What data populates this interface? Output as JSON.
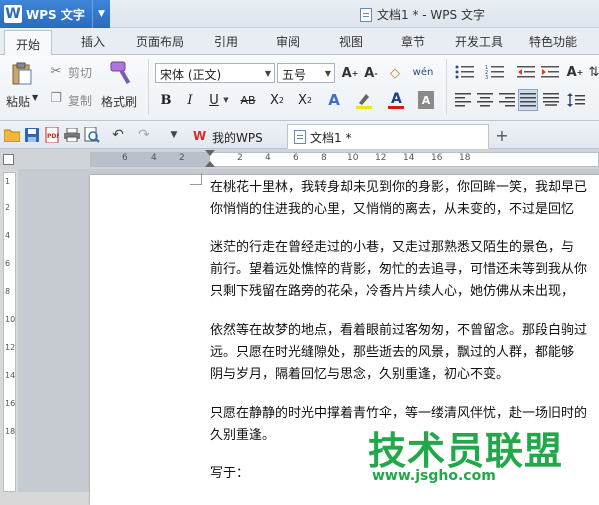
{
  "app": {
    "name": "WPS 文字",
    "window_title": "文档1 * - WPS 文字"
  },
  "ribbon_tabs": [
    "开始",
    "插入",
    "页面布局",
    "引用",
    "审阅",
    "视图",
    "章节",
    "开发工具",
    "特色功能"
  ],
  "clipboard": {
    "paste": "粘贴",
    "cut": "剪切",
    "copy": "复制",
    "format_painter": "格式刷"
  },
  "font": {
    "family": "宋体 (正文)",
    "size": "五号",
    "font_color": "#d21c1c",
    "highlight_color": "#f2e21b"
  },
  "document_tabs": [
    {
      "label": "我的WPS"
    },
    {
      "label": "文档1 *"
    }
  ],
  "ruler": {
    "h_numbers": [
      "6",
      "4",
      "2",
      "2",
      "4",
      "6",
      "8",
      "10",
      "12",
      "14",
      "16",
      "18"
    ],
    "v_numbers": [
      "1",
      "2",
      "4",
      "6",
      "8",
      "10",
      "12",
      "14",
      "16",
      "18"
    ]
  },
  "document": {
    "paragraphs": [
      {
        "lines": [
          "在桃花十里林，我转身却未见到你的身影，你回眸一笑，我却早已",
          "你悄悄的住进我的心里，又悄悄的离去，从未变的，不过是回忆"
        ]
      },
      {
        "lines": [
          "迷茫的行走在曾经走过的小巷，又走过那熟悉又陌生的景色，与",
          "前行。望着远处憔悴的背影，匆忙的去追寻，可惜还未等到我从你",
          "只剩下残留在路旁的花朵，冷香片片续人心，她仿佛从未出现，"
        ]
      },
      {
        "lines": [
          "依然等在故梦的地点，看着眼前过客匆匆，不曾留念。那段白驹过",
          "远。只愿在时光缝隙处，那些逝去的风景，飘过的人群，都能够",
          "阴与岁月，隔着回忆与思念，久别重逢，初心不变。"
        ]
      },
      {
        "lines": [
          "只愿在静静的时光中撑着青竹伞，等一缕清风伴忧，赴一场旧时的",
          "久别重逢。"
        ]
      },
      {
        "lines": [
          "写于："
        ]
      }
    ]
  },
  "watermark": {
    "brand": "技术员联盟",
    "url": "www.jsgho.com"
  }
}
